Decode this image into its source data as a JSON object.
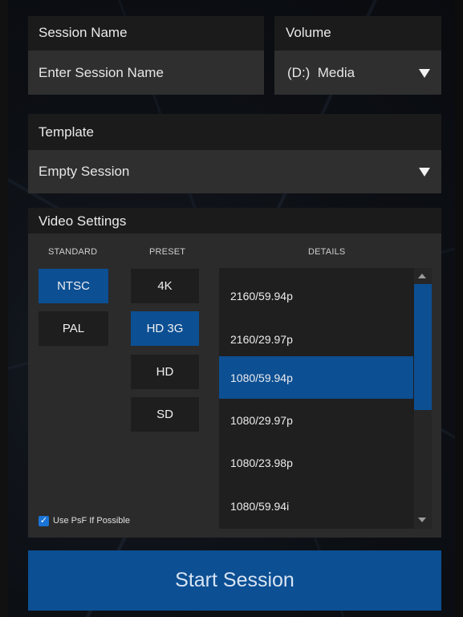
{
  "session": {
    "label": "Session Name",
    "placeholder": "Enter Session Name"
  },
  "volume": {
    "label": "Volume",
    "value": "(D:)  Media"
  },
  "template": {
    "label": "Template",
    "value": "Empty Session"
  },
  "video_settings": {
    "label": "Video Settings",
    "columns": {
      "standard": "STANDARD",
      "preset": "PRESET",
      "details": "DETAILS"
    },
    "standards": [
      "NTSC",
      "PAL"
    ],
    "selected_standard": "NTSC",
    "presets": [
      "4K",
      "HD 3G",
      "HD",
      "SD"
    ],
    "selected_preset": "HD 3G",
    "details": [
      "2160/59.94p",
      "2160/29.97p",
      "1080/59.94p",
      "1080/29.97p",
      "1080/23.98p",
      "1080/59.94i"
    ],
    "selected_detail": "1080/59.94p",
    "psf": {
      "label": "Use PsF If Possible",
      "checked": true
    }
  },
  "start_button": "Start Session",
  "colors": {
    "accent": "#0c4f93",
    "field": "#2f2f2f",
    "panel": "#2b2b2b"
  }
}
